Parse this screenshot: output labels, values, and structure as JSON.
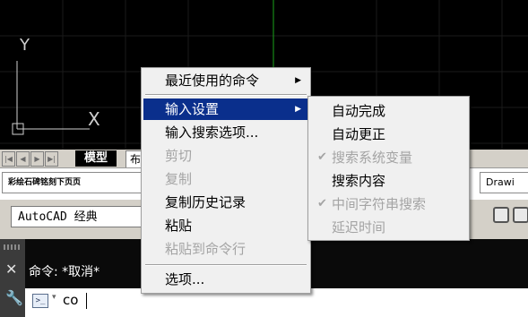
{
  "ucs_icon": {
    "x_label": "X",
    "y_label": "Y"
  },
  "layout_tabs": {
    "nav_buttons": [
      "|◀",
      "◀",
      "▶",
      "▶|"
    ],
    "model": "模型",
    "layout": "布"
  },
  "file_tabs": [
    {
      "label": "彩绘石碑铭刻下页页"
    },
    {
      "label": "Drawi"
    }
  ],
  "workspace": {
    "combo": "AutoCAD 经典"
  },
  "command_line": {
    "history": "命令: *取消*",
    "prompt_icon": ">_",
    "input": "co"
  },
  "context_menu": {
    "items": [
      {
        "label": "最近使用的命令",
        "submenu": true
      },
      {
        "separator": true
      },
      {
        "label": "输入设置",
        "submenu": true,
        "active": true
      },
      {
        "label": "输入搜索选项..."
      },
      {
        "label": "剪切",
        "disabled": true
      },
      {
        "label": "复制",
        "disabled": true
      },
      {
        "label": "复制历史记录"
      },
      {
        "label": "粘贴"
      },
      {
        "label": "粘贴到命令行",
        "disabled": true
      },
      {
        "separator": true
      },
      {
        "label": "选项..."
      }
    ]
  },
  "submenu": {
    "items": [
      {
        "label": "自动完成"
      },
      {
        "label": "自动更正"
      },
      {
        "label": "搜索系统变量",
        "checked": true,
        "disabled": true
      },
      {
        "label": "搜索内容"
      },
      {
        "label": "中间字符串搜索",
        "checked": true,
        "disabled": true
      },
      {
        "label": "延迟时间",
        "disabled": true
      }
    ]
  },
  "colors": {
    "menu_highlight": "#0a2f8c",
    "canvas": "#000000",
    "green_axis": "#1aa31a"
  }
}
